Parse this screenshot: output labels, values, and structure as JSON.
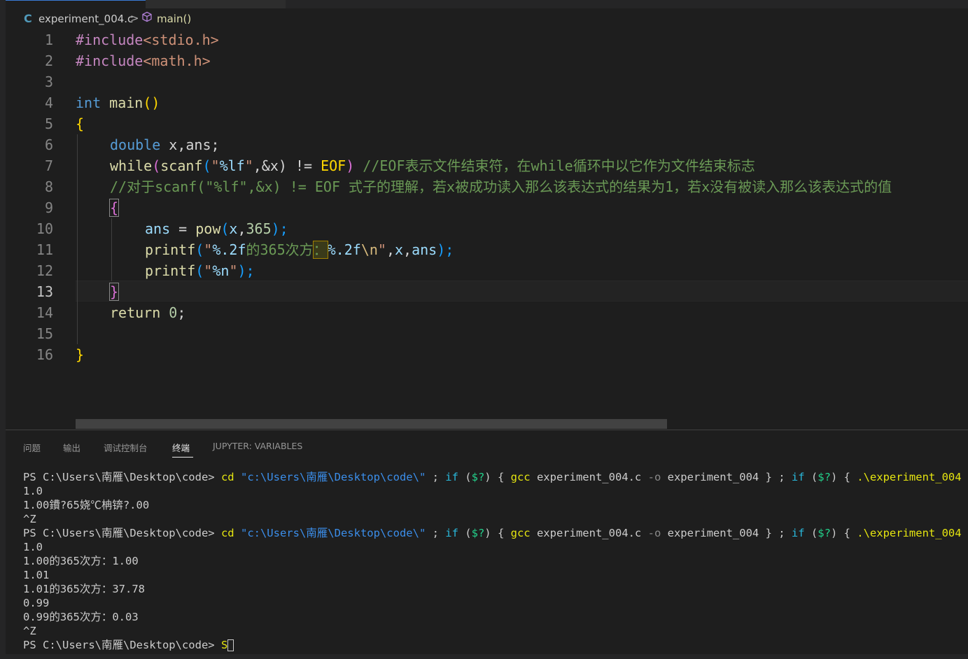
{
  "breadcrumb": {
    "lang_icon": "C",
    "file": "experiment_004.c",
    "separator": ">",
    "symbol_icon": "cube-icon",
    "symbol": "main()"
  },
  "editor": {
    "active_line": "13",
    "line_numbers": [
      "1",
      "2",
      "3",
      "4",
      "5",
      "6",
      "7",
      "8",
      "9",
      "10",
      "11",
      "12",
      "13",
      "14",
      "15",
      "16"
    ],
    "code": {
      "l1": {
        "a": "#include",
        "b": "<stdio.h>"
      },
      "l2": {
        "a": "#include",
        "b": "<math.h>"
      },
      "l4": {
        "a": "int",
        "b": " ",
        "c": "main",
        "d": "()"
      },
      "l5": {
        "a": "{"
      },
      "l6": {
        "a": "double",
        "b": " x,ans;"
      },
      "l7": {
        "a": "while",
        "b": "(",
        "c": "scanf",
        "d": "(",
        "e": "\"",
        "f": "%lf",
        "g": "\"",
        "h": ",&x) != ",
        "i": "EOF",
        "j": ")",
        "k": " //EOF表示文件结束符，在while循环中以它作为文件结束标志"
      },
      "l8": {
        "a": "//对于scanf(\"%lf\",&x) != EOF 式子的理解，若x被成功读入那么该表达式的结果为1，若x没有被读入那么该表达式的值"
      },
      "l9": {
        "a": "{"
      },
      "l10": {
        "a": "ans",
        "b": " = ",
        "c": "pow",
        "d": "(",
        "e": "x",
        "f": ",",
        "g": "365",
        "h": ");"
      },
      "l11": {
        "a": "printf",
        "b": "(",
        "c": "\"",
        "d": "%.2f",
        "e": "的365次方",
        "f": "：",
        "g": "%.2f",
        "h": "\\n",
        "i": "\"",
        "j": ",",
        "k": "x",
        "l": ",",
        "m": "ans",
        "n": ");"
      },
      "l12": {
        "a": "printf",
        "b": "(",
        "c": "\"",
        "d": "%n",
        "e": "\"",
        "f": ");"
      },
      "l13": {
        "a": "}"
      },
      "l14": {
        "a": "return",
        "b": " ",
        "c": "0",
        "d": ";"
      },
      "l16": {
        "a": "}"
      }
    }
  },
  "panel": {
    "tabs": [
      "问题",
      "输出",
      "调试控制台",
      "终端",
      "JUPYTER: VARIABLES"
    ],
    "active_tab": "终端"
  },
  "terminal": {
    "prompt": "PS C:\\Users\\南雁\\Desktop\\code> ",
    "cmd": {
      "cd": "cd",
      "path": "\"c:\\Users\\南雁\\Desktop\\code\\\"",
      "semi1": " ; ",
      "if1": "if",
      "cond1a": " (",
      "cond1b": "$?",
      "cond1c": ") { ",
      "gcc": "gcc",
      "gcc_args1": " experiment_004.c ",
      "opt": "-o",
      "gcc_args2": " experiment_004 } ; ",
      "if2": "if",
      "cond2a": " (",
      "cond2b": "$?",
      "cond2c": ") { ",
      "run": ".\\experiment_004",
      "end": " }"
    },
    "out": {
      "o1": "1.0",
      "o2": "1.00鐨?65娆℃柟锛?.00",
      "o3": "^Z",
      "o4": "1.0",
      "o5": "1.00的365次方：1.00",
      "o6": "1.01",
      "o7": "1.01的365次方：37.78",
      "o8": "0.99",
      "o9": "0.99的365次方：0.03",
      "o10": "^Z",
      "typed": "S"
    }
  },
  "colors": {
    "editor_bg": "#1e1e1e",
    "keyword": "#569cd6",
    "function": "#dcdcaa",
    "string": "#ce9178",
    "comment": "#6a9955",
    "variable": "#9cdcfe",
    "number": "#b5cea8",
    "brace_gold": "#ffd700",
    "brace_purple": "#da70d6",
    "terminal_yellow": "#e5e510",
    "terminal_blue": "#3b8eea"
  }
}
